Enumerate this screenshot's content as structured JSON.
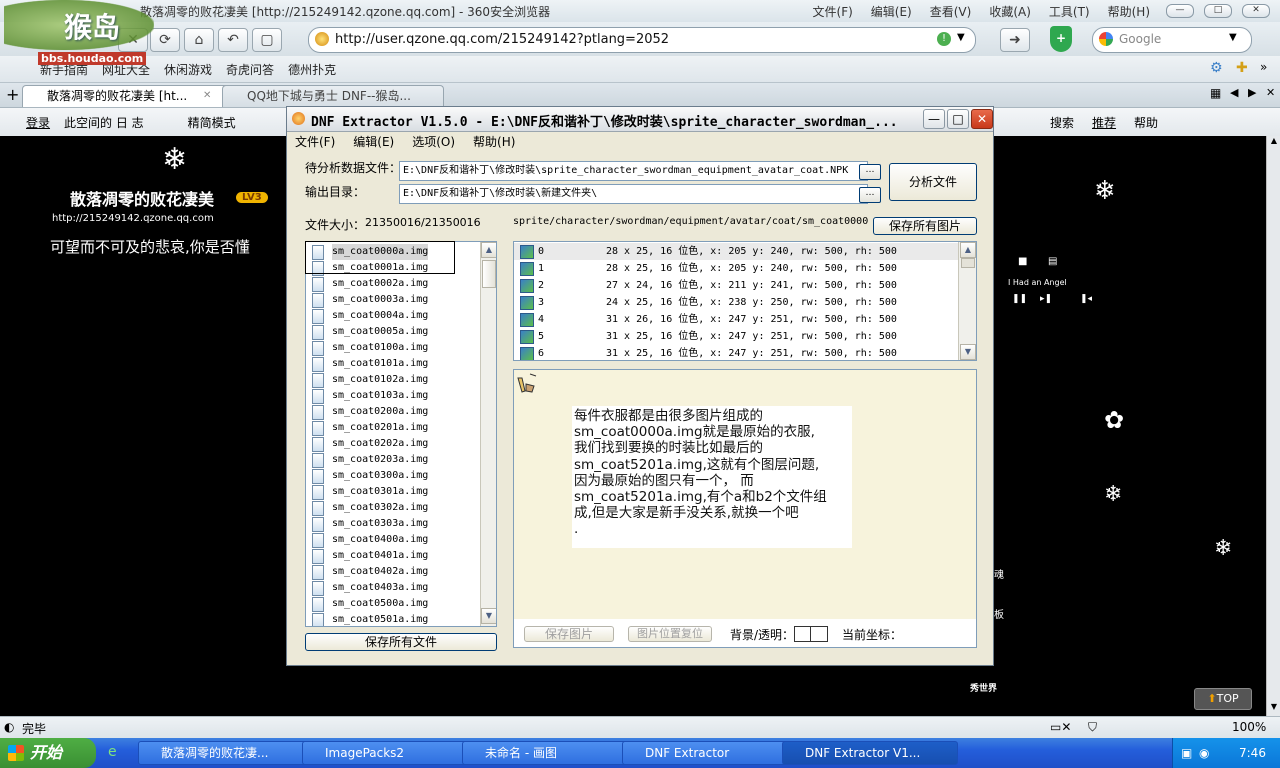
{
  "browser": {
    "title": "散落凋零的败花凄美 [http://215249142.qzone.qq.com] - 360安全浏览器",
    "logo_text": "bbs.houdao.com",
    "menu": [
      "文件(F)",
      "编辑(E)",
      "查看(V)",
      "收藏(A)",
      "工具(T)",
      "帮助(H)"
    ],
    "address": "http://user.qzone.qq.com/215249142?ptlang=2052",
    "search_placeholder": "Google",
    "favorites": [
      "新手指南",
      "网址大全",
      "休闲游戏",
      "奇虎问答",
      "德州扑克"
    ],
    "tabs": [
      "散落凋零的败花凄美 [ht...",
      "QQ地下城与勇士 DNF--猴岛..."
    ],
    "qzone_left": [
      "登录",
      "此空间的 日 志",
      "精简模式"
    ],
    "qzone_right": [
      "搜索",
      "推荐",
      "帮助"
    ],
    "status": "完毕",
    "zoom": "100%"
  },
  "page": {
    "blog_title": "散落凋零的败花凄美",
    "level": "LV3",
    "url": "http://215249142.qzone.qq.com",
    "tagline": "可望而不可及的悲哀,你是否懂",
    "player_song": "I Had an Angel",
    "top_button": "TOP",
    "side_text": [
      "魂",
      "板",
      "秀世界"
    ]
  },
  "taskbar": {
    "start": "开始",
    "tasks": [
      "散落凋零的败花凄...",
      "ImagePacks2",
      "未命名 - 画图",
      "DNF Extractor",
      "DNF Extractor V1..."
    ],
    "clock": "7:46"
  },
  "dnf": {
    "title": "DNF Extractor V1.5.0 - E:\\DNF反和谐补丁\\修改时装\\sprite_character_swordman_...",
    "menu": [
      "文件(F)",
      "编辑(E)",
      "选项(O)",
      "帮助(H)"
    ],
    "input_label": "待分析数据文件：",
    "input_value": "E:\\DNF反和谐补丁\\修改时装\\sprite_character_swordman_equipment_avatar_coat.NPK",
    "output_label": "输出目录：",
    "output_value": "E:\\DNF反和谐补丁\\修改时装\\新建文件夹\\",
    "analyze_button": "分析文件",
    "file_size_label": "文件大小：",
    "file_size": "21350016/21350016",
    "sprite_path": "sprite/character/swordman/equipment/avatar/coat/sm_coat0000",
    "save_all_images": "保存所有图片",
    "files": [
      "sm_coat0000a.img",
      "sm_coat0001a.img",
      "sm_coat0002a.img",
      "sm_coat0003a.img",
      "sm_coat0004a.img",
      "sm_coat0005a.img",
      "sm_coat0100a.img",
      "sm_coat0101a.img",
      "sm_coat0102a.img",
      "sm_coat0103a.img",
      "sm_coat0200a.img",
      "sm_coat0201a.img",
      "sm_coat0202a.img",
      "sm_coat0203a.img",
      "sm_coat0300a.img",
      "sm_coat0301a.img",
      "sm_coat0302a.img",
      "sm_coat0303a.img",
      "sm_coat0400a.img",
      "sm_coat0401a.img",
      "sm_coat0402a.img",
      "sm_coat0403a.img",
      "sm_coat0500a.img",
      "sm_coat0501a.img"
    ],
    "save_all_files": "保存所有文件",
    "frames": [
      {
        "index": "0",
        "info": "28 x 25, 16 位色, x: 205 y: 240, rw: 500, rh: 500"
      },
      {
        "index": "1",
        "info": "28 x 25, 16 位色, x: 205 y: 240, rw: 500, rh: 500"
      },
      {
        "index": "2",
        "info": "27 x 24, 16 位色, x: 211 y: 241, rw: 500, rh: 500"
      },
      {
        "index": "3",
        "info": "24 x 25, 16 位色, x: 238 y: 250, rw: 500, rh: 500"
      },
      {
        "index": "4",
        "info": "31 x 26, 16 位色, x: 247 y: 251, rw: 500, rh: 500"
      },
      {
        "index": "5",
        "info": "31 x 25, 16 位色, x: 247 y: 251, rw: 500, rh: 500"
      },
      {
        "index": "6",
        "info": "31 x 25, 16 位色, x: 247 y: 251, rw: 500, rh: 500"
      }
    ],
    "annotation_lines": [
      "每件衣服都是由很多图片组成的",
      "sm_coat0000a.img就是最原始的衣服,",
      "我们找到要换的时装比如最后的",
      "sm_coat5201a.img,这就有个图层问题,",
      "因为最原始的图只有一个， 而",
      "sm_coat5201a.img,有个a和b2个文件组",
      "成,但是大家是新手没关系,就换一个吧",
      "."
    ],
    "save_image": "保存图片",
    "reset_position": "图片位置复位",
    "bg_transparency": "背景/透明：",
    "current_coords": "当前坐标："
  }
}
